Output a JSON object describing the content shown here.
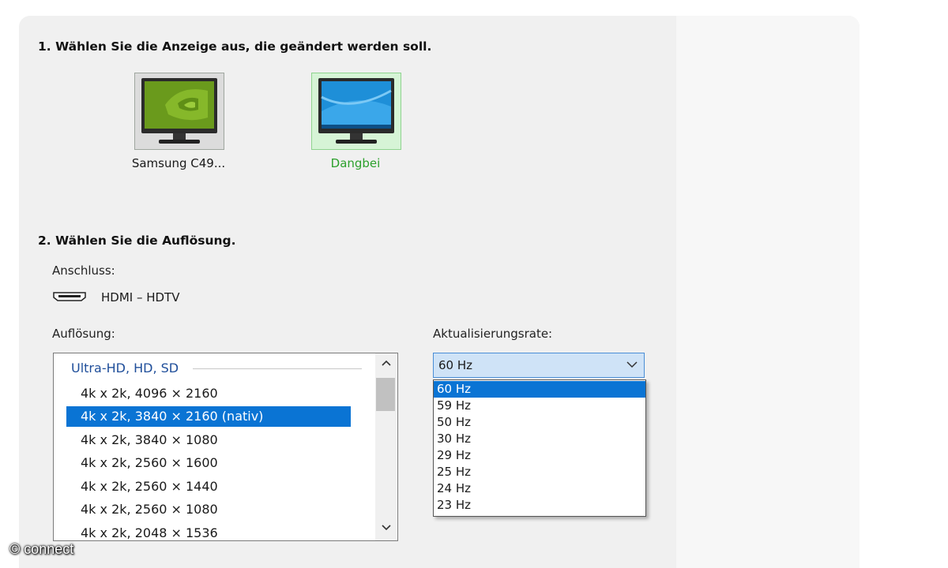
{
  "step1": {
    "heading": "1. Wählen Sie die Anzeige aus, die geändert werden soll.",
    "displays": [
      {
        "name": "Samsung C49...",
        "icon": "nvidia-monitor-icon",
        "selected": false
      },
      {
        "name": "Dangbei",
        "icon": "windows-monitor-icon",
        "selected": true
      }
    ]
  },
  "step2": {
    "heading": "2. Wählen Sie die Auflösung.",
    "connection_label": "Anschluss:",
    "connection_icon": "hdmi-connector-icon",
    "connection_value": "HDMI – HDTV",
    "resolution_label": "Auflösung:",
    "resolution_group": "Ultra-HD, HD, SD",
    "resolutions": [
      "4k x 2k, 4096 × 2160",
      "4k x 2k, 3840 × 2160 (nativ)",
      "4k x 2k, 3840 × 1080",
      "4k x 2k, 2560 × 1600",
      "4k x 2k, 2560 × 1440",
      "4k x 2k, 2560 × 1080",
      "4k x 2k, 2048 × 1536"
    ],
    "selected_resolution": "4k x 2k, 3840 × 2160 (nativ)",
    "refresh_label": "Aktualisierungsrate:",
    "refresh_selected": "60 Hz",
    "refresh_options": [
      "60 Hz",
      "59 Hz",
      "50 Hz",
      "30 Hz",
      "29 Hz",
      "25 Hz",
      "24 Hz",
      "23 Hz"
    ]
  },
  "watermark": "© connect",
  "colors": {
    "selection": "#0a74d4",
    "selected_display_text": "#2ca02c",
    "group_heading": "#1f4e9a",
    "nvidia_green": "#76b900"
  }
}
